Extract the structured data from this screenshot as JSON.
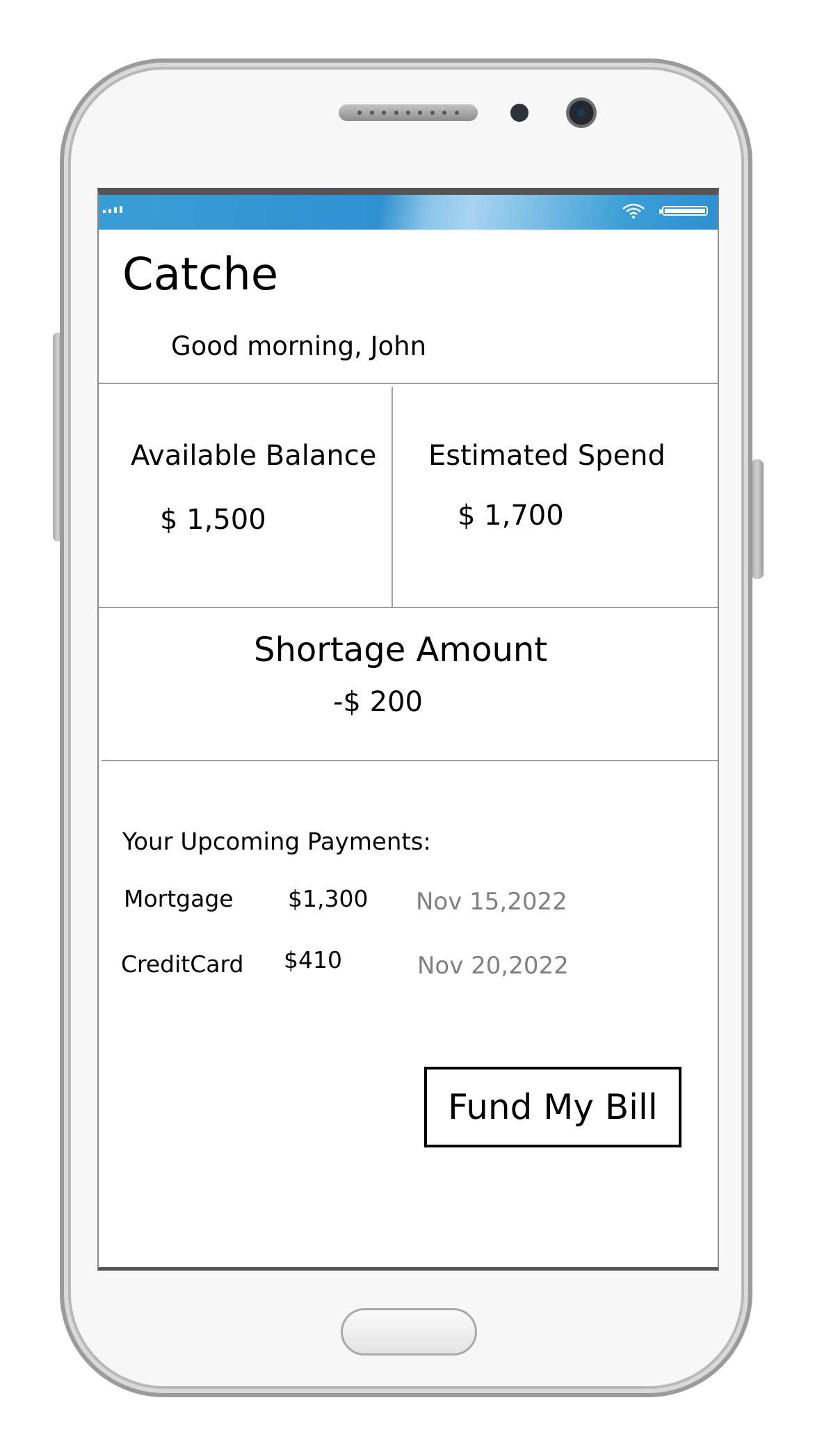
{
  "status_bar": {
    "signal_icon": "signal-bars-icon",
    "wifi_icon": "wifi-icon",
    "battery_icon": "battery-icon"
  },
  "header": {
    "app_title": "Catche",
    "greeting": "Good morning, John"
  },
  "balance": {
    "label": "Available Balance",
    "value": "$ 1,500"
  },
  "spend": {
    "label": "Estimated Spend",
    "value": "$ 1,700"
  },
  "shortage": {
    "label": "Shortage Amount",
    "value": "-$ 200"
  },
  "payments": {
    "heading": "Your Upcoming Payments:",
    "items": [
      {
        "name": "Mortgage",
        "amount": "$1,300",
        "date": "Nov 15,2022"
      },
      {
        "name": "CreditCard",
        "amount": "$410",
        "date": "Nov 20,2022"
      }
    ]
  },
  "actions": {
    "fund_label": "Fund My Bill"
  },
  "colors": {
    "status_bar": "#2f91d0",
    "date_text": "#808080",
    "divider": "#a0a0a0"
  }
}
